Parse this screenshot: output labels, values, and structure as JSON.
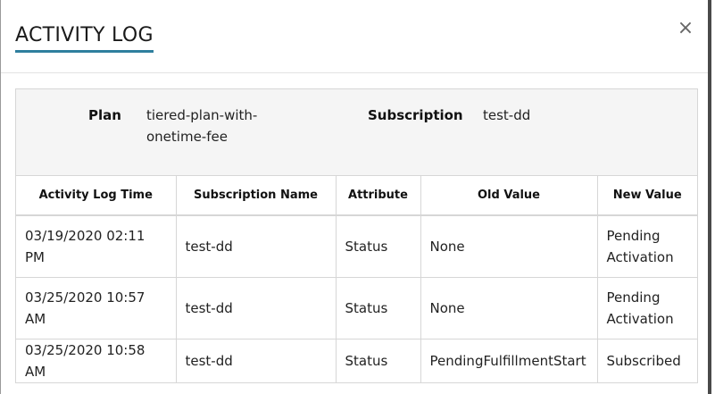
{
  "modal": {
    "title": "ACTIVITY LOG",
    "close_label": "×"
  },
  "summary": {
    "plan_label": "Plan",
    "plan_value_line1": "tiered-plan-with-",
    "plan_value_line2": "onetime-fee",
    "subscription_label": "Subscription",
    "subscription_value": "test-dd"
  },
  "table": {
    "columns": [
      "Activity Log Time",
      "Subscription Name",
      "Attribute",
      "Old Value",
      "New Value"
    ],
    "rows": [
      [
        "03/19/2020 02:11 PM",
        "test-dd",
        "Status",
        "None",
        "Pending Activation"
      ],
      [
        "03/25/2020 10:57 AM",
        "test-dd",
        "Status",
        "None",
        "Pending Activation"
      ],
      [
        "03/25/2020 10:58 AM",
        "test-dd",
        "Status",
        "PendingFulfillmentStart",
        "Subscribed"
      ]
    ]
  },
  "colors": {
    "title_underline": "#2f7f9e",
    "summary_bg": "#f5f5f5"
  }
}
